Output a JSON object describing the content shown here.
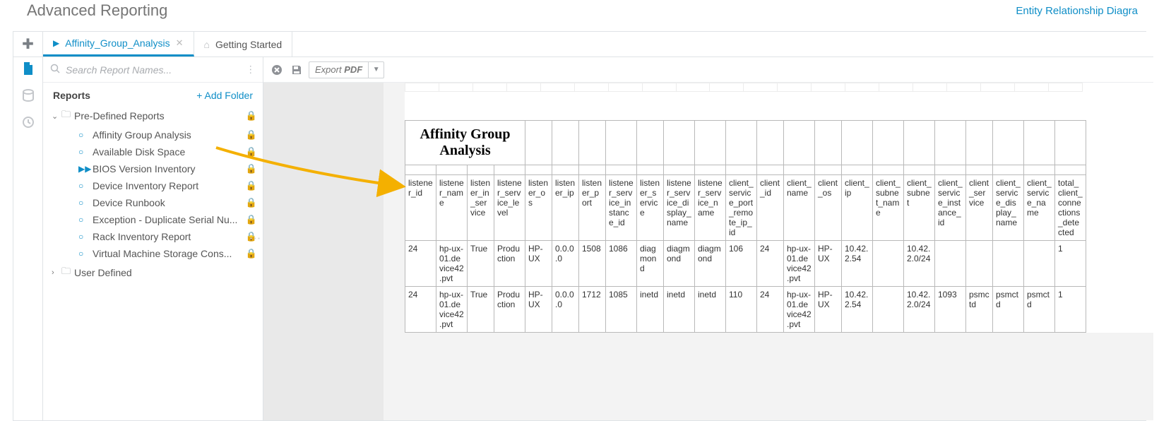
{
  "header": {
    "title": "Advanced Reporting",
    "erd_link": "Entity Relationship Diagra"
  },
  "tabs": {
    "active_label": "Affinity_Group_Analysis",
    "second_label": "Getting Started"
  },
  "sidebar": {
    "search_placeholder": "Search Report Names...",
    "reports_heading": "Reports",
    "add_folder": "+ Add Folder",
    "folder1": "Pre-Defined Reports",
    "folder2": "User Defined",
    "items": {
      "affinity": "Affinity Group Analysis",
      "disk": "Available Disk Space",
      "bios": "BIOS Version Inventory",
      "devinv": "Device Inventory Report",
      "runbook": "Device Runbook",
      "exception": "Exception - Duplicate Serial Nu...",
      "rack": "Rack Inventory Report",
      "vm": "Virtual Machine Storage Cons..."
    }
  },
  "toolbar": {
    "export_pre": "Export",
    "export_bold": "PDF"
  },
  "report": {
    "title": "Affinity Group Analysis",
    "headers": [
      "listener_id",
      "listener_name",
      "listener_in_service",
      "listener_service_level",
      "listener_os",
      "listener_ip",
      "listener_port",
      "listener_service_instance_id",
      "listener_service",
      "listener_service_display_name",
      "listener_service_name",
      "client_service_port_remote_ip_id",
      "client_id",
      "client_name",
      "client_os",
      "client_ip",
      "client_subnet_name",
      "client_subnet",
      "client_service_instance_id",
      "client_service",
      "client_service_display_name",
      "client_service_name",
      "total_client_connections_detected"
    ],
    "rows": [
      [
        "24",
        "hp-ux-01.device42.pvt",
        "True",
        "Production",
        "HP-UX",
        "0.0.0.0",
        "1508",
        "1086",
        "diagmond",
        "diagmond",
        "diagmond",
        "106",
        "24",
        "hp-ux-01.device42.pvt",
        "HP-UX",
        "10.42.2.54",
        "",
        "10.42.2.0/24",
        "",
        "",
        "",
        "",
        "1"
      ],
      [
        "24",
        "hp-ux-01.device42.pvt",
        "True",
        "Production",
        "HP-UX",
        "0.0.0.0",
        "1712",
        "1085",
        "inetd",
        "inetd",
        "inetd",
        "110",
        "24",
        "hp-ux-01.device42.pvt",
        "HP-UX",
        "10.42.2.54",
        "",
        "10.42.2.0/24",
        "1093",
        "psmctd",
        "psmctd",
        "psmctd",
        "1"
      ]
    ]
  }
}
